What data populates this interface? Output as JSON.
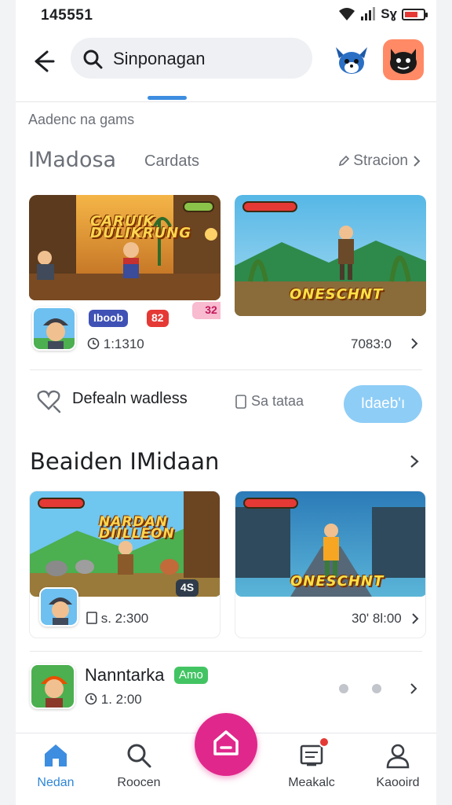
{
  "status_bar": {
    "time": "145551",
    "carrier": "Sɣ"
  },
  "header": {
    "search_text": "Sinponagan"
  },
  "section_caption": "Aadenc na gams",
  "tabs": {
    "primary": "IMadosa",
    "secondary": "Cardats",
    "right_link": "Stracion"
  },
  "featured": [
    {
      "art_title": "CARUIK\nDULIKRUNG",
      "badge1": "Iboob",
      "badge2": "82",
      "price_tag": "32",
      "stat": "1:1310"
    },
    {
      "art_title": "ONESCHNT",
      "stat": "7083:0"
    }
  ],
  "follow_row": {
    "text": "Defealn wadless",
    "secondary": "Sa tataa",
    "button": "Idaeb'ı"
  },
  "section2": {
    "title": "Beaiden IMidaan"
  },
  "grid": [
    {
      "art_title": "NARDAN\nDIILLEON",
      "art_tag": "4S",
      "stat": "s. 2:300"
    },
    {
      "art_title": "ONESCHNT",
      "stat": "30' 8l:00"
    }
  ],
  "list_item": {
    "title": "Nanntarka",
    "tag": "Amo",
    "sub": "1. 2:00"
  },
  "bottom_nav": [
    {
      "label": "Nedan",
      "icon": "home-icon"
    },
    {
      "label": "Roocen",
      "icon": "search-icon"
    },
    {
      "label": "Meakalc",
      "icon": "inbox-icon"
    },
    {
      "label": "Kaooird",
      "icon": "profile-icon"
    }
  ],
  "colors": {
    "accent": "#2f86d6",
    "fab": "#e0288c",
    "follow_button": "#8ecdf6",
    "tag_green": "#43c463"
  }
}
